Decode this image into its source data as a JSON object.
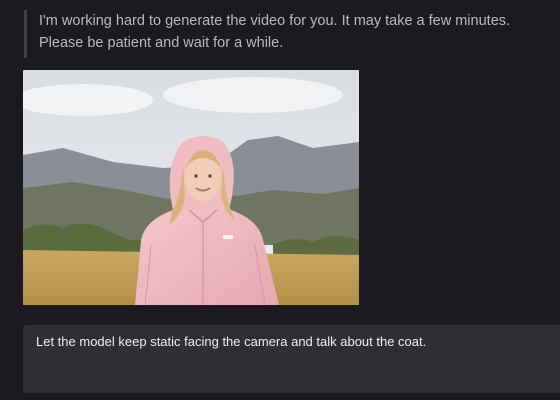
{
  "status": {
    "line1": "I'm working hard to generate the video for you. It may take a few minutes.",
    "line2": "Please be patient and wait for a while."
  },
  "preview": {
    "icon": "generated-video-preview-image"
  },
  "prompt": {
    "text": "Let the model keep static facing the camera and talk about the coat."
  },
  "colors": {
    "background": "#1b1b1f",
    "status_text": "#b9b9c0",
    "status_border": "#3f3f46",
    "prompt_bg": "#2e2e33",
    "prompt_text": "#f0f0f2",
    "coat_pink": "#efb9bf"
  }
}
